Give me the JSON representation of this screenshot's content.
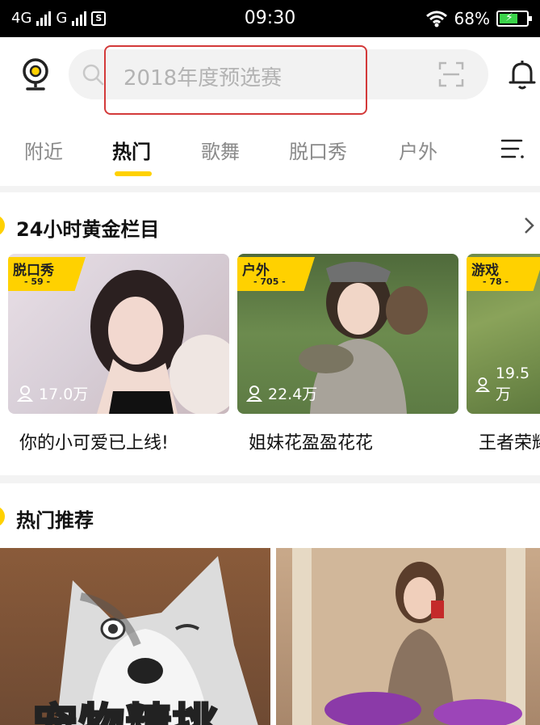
{
  "status_bar": {
    "network1": "4G",
    "network2": "G",
    "sim_icon": "S",
    "time": "09:30",
    "battery": "68%",
    "icons": [
      "wifi-icon",
      "battery-icon"
    ]
  },
  "header": {
    "search_placeholder": "2018年度预选赛",
    "icons": [
      "camera-icon",
      "search-icon",
      "scan-icon",
      "bell-icon"
    ]
  },
  "tabs": [
    {
      "label": "附近",
      "active": false
    },
    {
      "label": "热门",
      "active": true
    },
    {
      "label": "歌舞",
      "active": false
    },
    {
      "label": "脱口秀",
      "active": false
    },
    {
      "label": "户外",
      "active": false
    }
  ],
  "golden": {
    "title": "24小时黄金栏目",
    "cards": [
      {
        "badge": "脱口秀",
        "badge_num": "- 59 -",
        "viewers": "17.0万",
        "title": "你的小可爱已上线!"
      },
      {
        "badge": "户外",
        "badge_num": "- 705 -",
        "viewers": "22.4万",
        "title": "姐妹花盈盈花花"
      },
      {
        "badge": "游戏",
        "badge_num": "- 78 -",
        "viewers": "19.5万",
        "title": "王者荣耀"
      }
    ]
  },
  "hot": {
    "title": "热门推荐",
    "tiles": [
      {
        "overlay_text": "宠物精挑"
      },
      {
        "overlay_text": ""
      }
    ]
  },
  "colors": {
    "accent": "#ffd100",
    "highlight_box": "#d33a3a"
  }
}
